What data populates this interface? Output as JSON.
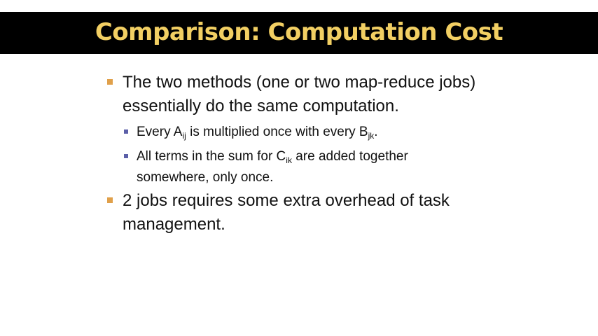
{
  "slide": {
    "title": "Comparison: Computation Cost",
    "bullets": [
      {
        "line1": "The two methods (one or two map-reduce jobs)",
        "line2": "essentially do the same computation."
      },
      {
        "line1": "2 jobs requires some extra overhead of task",
        "line2": "management."
      }
    ],
    "subbullets": [
      {
        "part1": "Every A",
        "sub1": "ij",
        "part2": " is multiplied once with every B",
        "sub2": "jk",
        "part3": "."
      },
      {
        "part1": "All terms in the sum for C",
        "sub1": "ik",
        "part2": " are added together",
        "line2": "somewhere, only once."
      }
    ]
  }
}
